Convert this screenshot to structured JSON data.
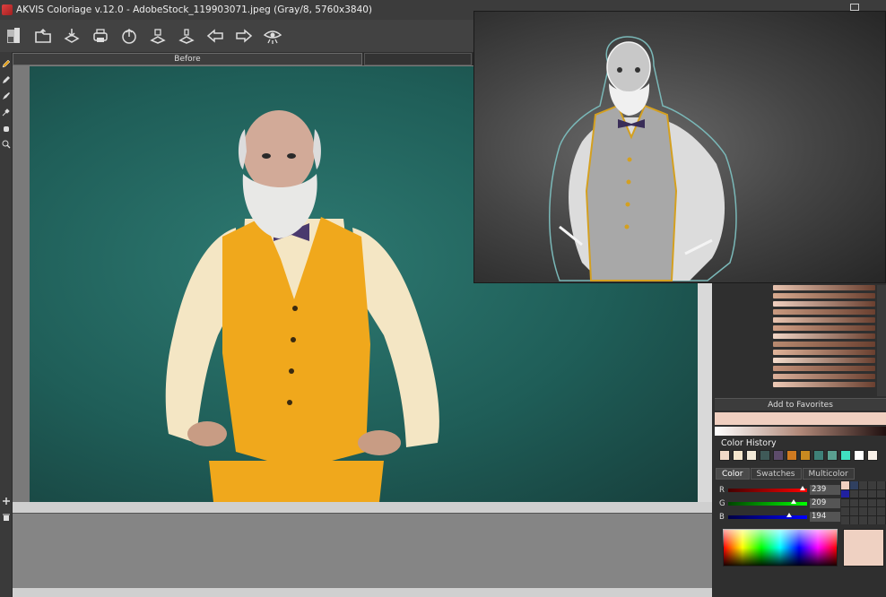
{
  "titlebar": {
    "title": "AKVIS Coloriage v.12.0 - AdobeStock_119903071.jpeg (Gray/8, 5760x3840)"
  },
  "toolbar": {
    "buttons": [
      {
        "name": "home-icon"
      },
      {
        "name": "open-icon"
      },
      {
        "name": "save-icon"
      },
      {
        "name": "print-icon"
      },
      {
        "name": "share-icon"
      },
      {
        "name": "batch-icon"
      },
      {
        "name": "plugin-icon"
      },
      {
        "name": "undo-arrow-icon"
      },
      {
        "name": "redo-arrow-icon"
      },
      {
        "name": "preview-eye-icon"
      }
    ]
  },
  "tabs": {
    "before_label": "Before"
  },
  "tools": [
    "pencil-icon",
    "eraser-icon",
    "magic-tube-icon",
    "eyedropper-icon",
    "hand-icon",
    "zoom-icon"
  ],
  "right_panel": {
    "add_favorites_label": "Add to Favorites",
    "color_history_title": "Color History",
    "color_history": [
      "#f0d8c8",
      "#f6e6cc",
      "#f3ead8",
      "#3f5a58",
      "#5d4b6b",
      "#d07a20",
      "#c88a20",
      "#3e8078",
      "#5aa090",
      "#40e0c0",
      "#ffffff",
      "#f8f0e8"
    ],
    "color_tabs": [
      "Color",
      "Swatches",
      "Multicolor"
    ],
    "active_color_tab": "Color",
    "rgb": {
      "r_label": "R",
      "r_value": "239",
      "g_label": "G",
      "g_value": "209",
      "b_label": "B",
      "b_value": "194"
    },
    "current_color": "#efd1c2",
    "skin_swatches": [
      "#e6c1ad",
      "#d9aa8f",
      "#f0d0c0",
      "#c99a80",
      "#e8c4b0",
      "#d2a086",
      "#f2d6c6",
      "#b88a70",
      "#e0b49a",
      "#f4dccc",
      "#c4927a",
      "#ddb09a",
      "#eecab6"
    ]
  },
  "colors": {
    "vest": "#f0a81c",
    "shirt": "#f4e6c4",
    "background": "#2a6e68",
    "bowtie": "#4a3a6e"
  }
}
